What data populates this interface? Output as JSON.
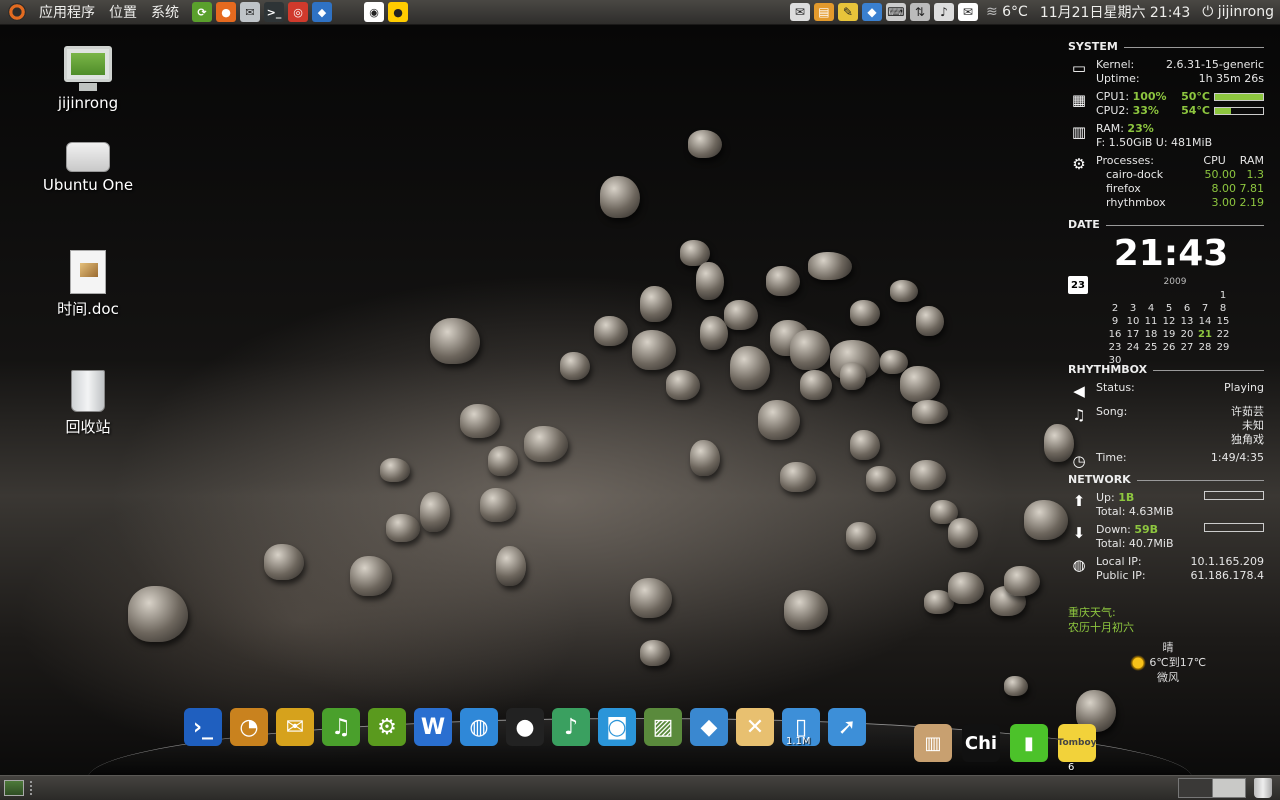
{
  "top_panel": {
    "menus": [
      "应用程序",
      "位置",
      "系统"
    ],
    "launchers": [
      {
        "name": "system-monitor-icon",
        "glyph": "⟳",
        "color": "#5aa02c"
      },
      {
        "name": "firefox-icon",
        "glyph": "●",
        "color": "#e66a1f"
      },
      {
        "name": "mail-icon",
        "glyph": "✉",
        "color": "#bfc4c8"
      },
      {
        "name": "terminal-icon",
        "glyph": ">_",
        "color": "#2e3436"
      },
      {
        "name": "help-lifebuoy-icon",
        "glyph": "◎",
        "color": "#d03a2c"
      },
      {
        "name": "network-icon",
        "glyph": "◆",
        "color": "#2f72c4"
      }
    ],
    "window_buttons": [
      {
        "name": "active-app-icon",
        "glyph": "◉",
        "color": "#ffffff"
      },
      {
        "name": "qq-icon",
        "glyph": "●",
        "color": "#ffcc00"
      }
    ],
    "tray": {
      "icons": [
        {
          "name": "notification-envelope-icon",
          "glyph": "✉",
          "color": "#dddddd"
        },
        {
          "name": "toolbox-icon",
          "glyph": "▤",
          "color": "#e39a2c"
        },
        {
          "name": "notepad-icon",
          "glyph": "✎",
          "color": "#e8c43a"
        },
        {
          "name": "network-manager-icon",
          "glyph": "◆",
          "color": "#3a80d0"
        },
        {
          "name": "keyboard-icon",
          "glyph": "⌨",
          "color": "#cccccc"
        },
        {
          "name": "wired-network-icon",
          "glyph": "⇅",
          "color": "#bbbbbb"
        },
        {
          "name": "volume-icon",
          "glyph": "♪",
          "color": "#dddddd"
        },
        {
          "name": "mail-indicator-icon",
          "glyph": "✉",
          "color": "#ffffff"
        }
      ],
      "weather": "6°C",
      "datetime": "11月21日星期六 21:43",
      "user": "jijinrong"
    }
  },
  "desktop_icons": [
    {
      "label": "jijinrong"
    },
    {
      "label": "Ubuntu One"
    },
    {
      "label": "时间.doc"
    },
    {
      "label": "回收站"
    }
  ],
  "conky": {
    "system": {
      "title": "SYSTEM",
      "kernel_label": "Kernel:",
      "kernel": "2.6.31-15-generic",
      "uptime_label": "Uptime:",
      "uptime": "1h 35m 26s",
      "cpu1_label": "CPU1:",
      "cpu1": "100%",
      "cpu1_temp": "50°C",
      "cpu1_level": 1.0,
      "cpu2_label": "CPU2:",
      "cpu2": "33%",
      "cpu2_temp": "54°C",
      "cpu2_level": 0.33,
      "ram_label": "RAM:",
      "ram": "23%",
      "ram_detail": "F: 1.50GiB U: 481MiB",
      "processes_label": "Processes:",
      "cpu_head": "CPU",
      "ram_head": "RAM",
      "processes": [
        {
          "name": "cairo-dock",
          "cpu": "50.00",
          "ram": "1.3"
        },
        {
          "name": "firefox",
          "cpu": "8.00",
          "ram": "7.81"
        },
        {
          "name": "rhythmbox",
          "cpu": "3.00",
          "ram": "2.19"
        }
      ]
    },
    "date": {
      "title": "DATE",
      "clock": "21:43",
      "calendar_icon_day": "23",
      "calendar_title": "2009",
      "days": [
        "",
        "",
        "",
        "",
        "",
        "",
        "1",
        "2",
        "3",
        "4",
        "5",
        "6",
        "7",
        "8",
        "9",
        "10",
        "11",
        "12",
        "13",
        "14",
        "15",
        "16",
        "17",
        "18",
        "19",
        "20",
        "21",
        "22",
        "23",
        "24",
        "25",
        "26",
        "27",
        "28",
        "29",
        "30"
      ],
      "today": "21"
    },
    "rhythmbox": {
      "title": "RHYTHMBOX",
      "status_label": "Status:",
      "status": "Playing",
      "song_label": "Song:",
      "artist": "许茹芸",
      "album": "未知",
      "track": "独角戏",
      "time_label": "Time:",
      "time": "1:49/4:35"
    },
    "network": {
      "title": "NETWORK",
      "up_label": "Up:",
      "up": "1B",
      "up_total_label": "Total:",
      "up_total": "4.63MiB",
      "down_label": "Down:",
      "down": "59B",
      "down_total_label": "Total:",
      "down_total": "40.7MiB",
      "local_ip_label": "Local IP:",
      "local_ip": "10.1.165.209",
      "public_ip_label": "Public IP:",
      "public_ip": "61.186.178.4"
    },
    "weather": {
      "city": "重庆天气:",
      "lunar": "农历十月初六",
      "condition": "晴",
      "range": "6℃到17℃",
      "wind": "微风"
    }
  },
  "dock": {
    "items": [
      {
        "name": "terminal-dock-icon",
        "glyph": "›_",
        "color": "#1f5fbf"
      },
      {
        "name": "firefox-dock-icon",
        "glyph": "◔",
        "color": "#c9821e"
      },
      {
        "name": "mail-dock-icon",
        "glyph": "✉",
        "color": "#d6a21c"
      },
      {
        "name": "music-dock-icon",
        "glyph": "♫",
        "color": "#4aa02c"
      },
      {
        "name": "ubuntu-dock-icon",
        "glyph": "⚙",
        "color": "#5a9a1e"
      },
      {
        "name": "text-dock-icon",
        "glyph": "W",
        "color": "#2a6fd0"
      },
      {
        "name": "globe-dock-icon",
        "glyph": "◍",
        "color": "#2f88d8"
      },
      {
        "name": "qq-dock-icon",
        "glyph": "●",
        "color": "#222222"
      },
      {
        "name": "player-dock-icon",
        "glyph": "♪",
        "color": "#3aa060"
      },
      {
        "name": "camera-dock-icon",
        "glyph": "◙",
        "color": "#2b95d9"
      },
      {
        "name": "image-dock-icon",
        "glyph": "▨",
        "color": "#5a8a3c"
      },
      {
        "name": "diamond-dock-icon",
        "glyph": "◆",
        "color": "#3a88d0"
      },
      {
        "name": "map-dock-icon",
        "glyph": "✕",
        "color": "#e8c070"
      },
      {
        "name": "trash-dock-icon",
        "glyph": "▯",
        "color": "#3d8fd8"
      },
      {
        "name": "share-dock-icon",
        "glyph": "➚",
        "color": "#3d8fd8"
      }
    ],
    "trash_size": "1.1M",
    "right_items": [
      {
        "name": "dictionary-dock-icon",
        "glyph": "▥",
        "color": "#c8a070"
      },
      {
        "name": "chi-dock-icon",
        "glyph": "Chi",
        "color": "#111111"
      },
      {
        "name": "battery-dock-icon",
        "glyph": "▮",
        "color": "#4cc22a"
      },
      {
        "name": "tomboy-dock-icon",
        "glyph": "Tomboy",
        "color": "#f2d23a"
      }
    ],
    "tomboy_count": "6"
  },
  "colors": {
    "accent": "#8dc63f",
    "panel": "#3c3b38"
  }
}
